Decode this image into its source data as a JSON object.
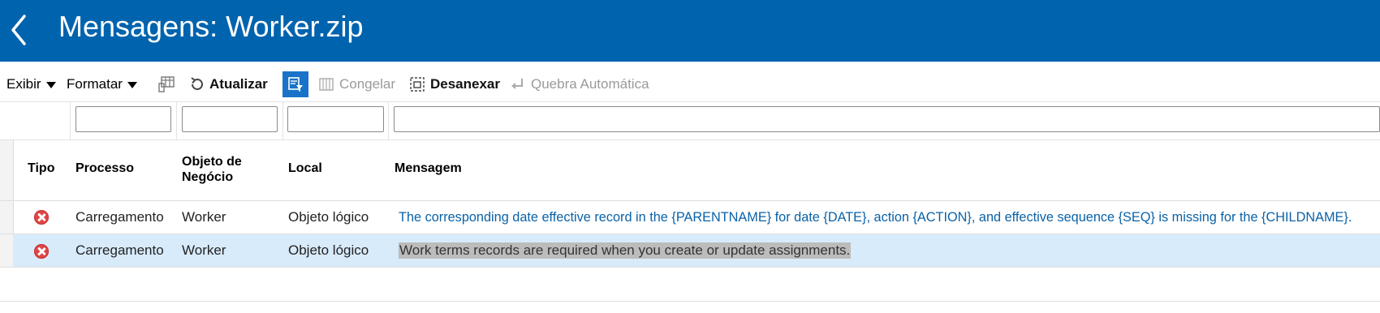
{
  "header": {
    "title": "Mensagens: Worker.zip"
  },
  "toolbar": {
    "view_label": "Exibir",
    "format_label": "Formatar",
    "refresh_label": "Atualizar",
    "freeze_label": "Congelar",
    "detach_label": "Desanexar",
    "wrap_label": "Quebra Automática"
  },
  "table": {
    "columns": [
      "Tipo",
      "Processo",
      "Objeto de Negócio",
      "Local",
      "Mensagem"
    ],
    "rows": [
      {
        "type_icon": "error-icon",
        "process": "Carregamento",
        "business_object": "Worker",
        "location": "Objeto lógico",
        "message": "The corresponding date effective record in the {PARENTNAME} for date {DATE}, action {ACTION}, and effective sequence {SEQ} is missing for the {CHILDNAME}."
      },
      {
        "type_icon": "error-icon",
        "process": "Carregamento",
        "business_object": "Worker",
        "location": "Objeto lógico",
        "message": "Work terms records are required when you create or update assignments."
      }
    ]
  },
  "colors": {
    "header_bg": "#0063ae",
    "selected_row": "#d8ebfb",
    "link": "#0a62a8",
    "error": "#e04545"
  }
}
